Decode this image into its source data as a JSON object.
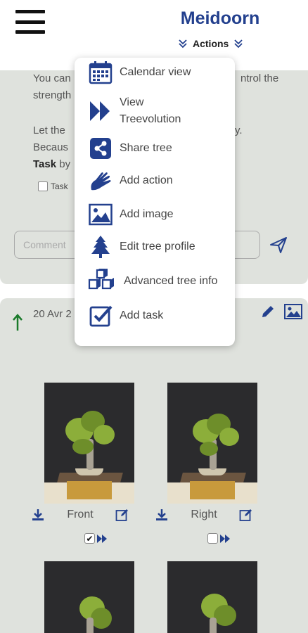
{
  "header": {
    "title": "Meidoorn",
    "actions_label": "Actions"
  },
  "card1": {
    "line1": "You can",
    "line1_tail": "ntrol the",
    "line2": "strength",
    "line3": "Let the",
    "line3_tail": "y.",
    "line4": "Becaus",
    "line5_bold": "Task",
    "line5": "by",
    "task_check_label": "Task",
    "comment_placeholder": "Comment"
  },
  "card2": {
    "date": "20 Avr 2",
    "photos": [
      {
        "label": "Front",
        "selected": true
      },
      {
        "label": "Right",
        "selected": false
      }
    ]
  },
  "menu": {
    "items": [
      {
        "label": "Calendar view",
        "icon": "calendar-icon"
      },
      {
        "label": "View Treevolution",
        "line1": "View",
        "line2": "Treevolution",
        "icon": "fast-forward-icon"
      },
      {
        "label": "Share tree",
        "icon": "share-icon"
      },
      {
        "label": "Add action",
        "icon": "hands-icon"
      },
      {
        "label": "Add image",
        "icon": "image-icon"
      },
      {
        "label": "Edit tree profile",
        "icon": "tree-icon"
      },
      {
        "label": "Advanced tree info",
        "icon": "cubes-icon"
      },
      {
        "label": "Add task",
        "icon": "checkbox-icon"
      }
    ]
  },
  "colors": {
    "brand": "#23408e",
    "card_bg": "#dfe2dd",
    "arrow_green": "#1a7a2a"
  }
}
